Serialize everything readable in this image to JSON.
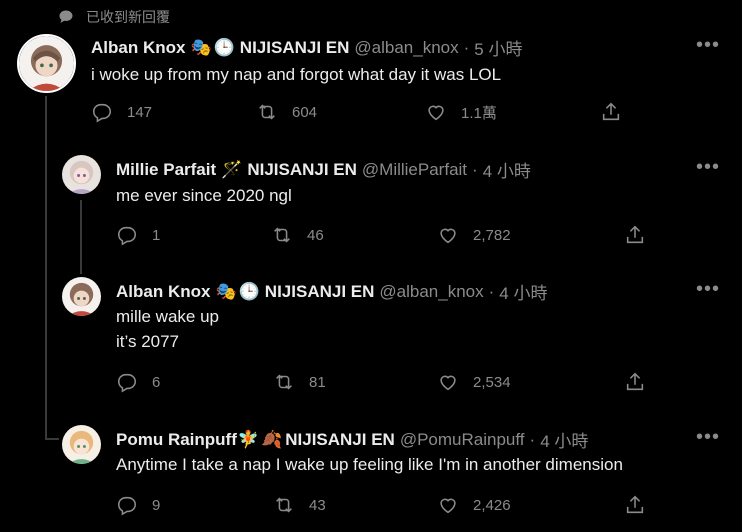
{
  "banner": "已收到新回覆",
  "tweets": [
    {
      "name": "Alban Knox",
      "emoji": [
        "🎭",
        "🕒"
      ],
      "org": "NIJISANJI EN",
      "handle": "@alban_knox",
      "time": "5 小時",
      "text": "i woke up from my nap and forgot what day it was LOL",
      "replies": "147",
      "retweets": "604",
      "likes": "1.1萬"
    },
    {
      "name": "Millie Parfait",
      "emoji": [
        "🪄"
      ],
      "org": "NIJISANJI EN",
      "handle": "@MillieParfait",
      "time": "4 小時",
      "text": "me ever since 2020 ngl",
      "replies": "1",
      "retweets": "46",
      "likes": "2,782"
    },
    {
      "name": "Alban Knox",
      "emoji": [
        "🎭",
        "🕒"
      ],
      "org": "NIJISANJI EN",
      "handle": "@alban_knox",
      "time": "4 小時",
      "text": "mille wake up\nit’s 2077",
      "replies": "6",
      "retweets": "81",
      "likes": "2,534"
    },
    {
      "name": "Pomu Rainpuff",
      "emoji": [
        "🧚",
        "🍂"
      ],
      "org": "NIJISANJI EN",
      "handle": "@PomuRainpuff",
      "time": "4 小時",
      "text": "Anytime I take a nap I wake up feeling like I'm in another dimension",
      "replies": "9",
      "retweets": "43",
      "likes": "2,426"
    }
  ],
  "icons": {
    "reply": "reply-icon",
    "retweet": "retweet-icon",
    "like": "heart-icon",
    "share": "share-icon",
    "more": "more-icon",
    "banner": "speech-bubble-icon"
  },
  "colors": {
    "background": "#000000",
    "text": "#ececec",
    "muted": "#8b8b8b",
    "thread_line": "#3a3a3a"
  }
}
